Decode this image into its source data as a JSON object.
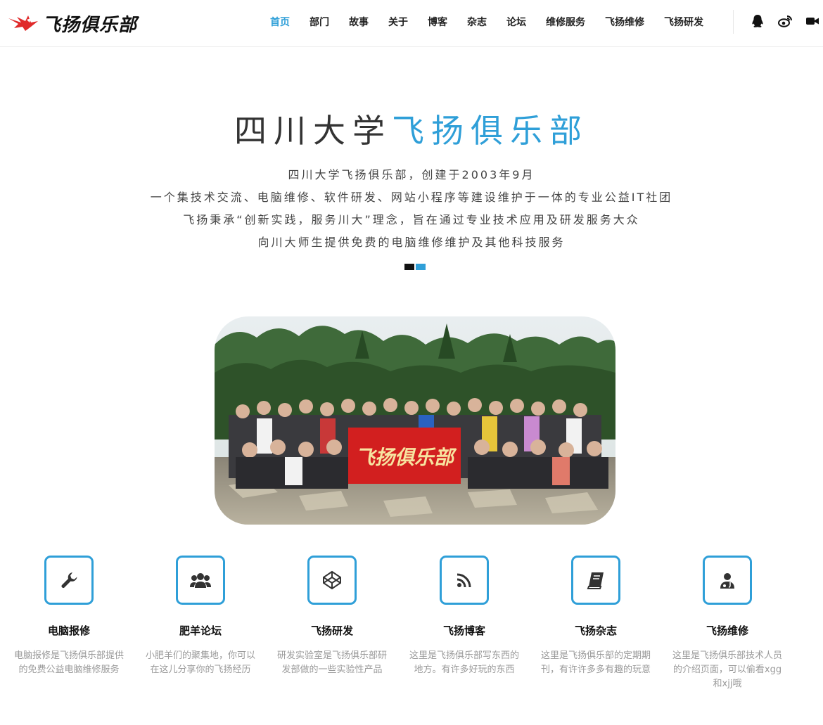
{
  "header": {
    "logo_text": "飞扬俱乐部",
    "nav": [
      {
        "label": "首页",
        "active": true
      },
      {
        "label": "部门"
      },
      {
        "label": "故事"
      },
      {
        "label": "关于"
      },
      {
        "label": "博客"
      },
      {
        "label": "杂志"
      },
      {
        "label": "论坛"
      },
      {
        "label": "维修服务"
      },
      {
        "label": "飞扬维修"
      },
      {
        "label": "飞扬研发"
      }
    ],
    "social_icons": [
      "qq-icon",
      "weibo-icon",
      "video-icon"
    ]
  },
  "hero": {
    "title_prefix": "四川大学",
    "title_highlight": "飞扬俱乐部",
    "lines": [
      "四川大学飞扬俱乐部，创建于2003年9月",
      "一个集技术交流、电脑维修、软件研发、网站小程序等建设维护于一体的专业公益IT社团",
      "飞扬秉承“创新实践，服务川大”理念，旨在通过专业技术应用及研发服务大众",
      "向川大师生提供免费的电脑维修维护及其他科技服务"
    ],
    "banner_text": "飞扬俱乐部"
  },
  "features": [
    {
      "icon": "wrench-icon",
      "title": "电脑报修",
      "desc": "电脑报修是飞扬俱乐部提供的免费公益电脑维修服务"
    },
    {
      "icon": "users-icon",
      "title": "肥羊论坛",
      "desc": "小肥羊们的聚集地，你可以在这儿分享你的飞扬经历"
    },
    {
      "icon": "codepen-icon",
      "title": "飞扬研发",
      "desc": "研发实验室是飞扬俱乐部研发部做的一些实验性产品"
    },
    {
      "icon": "rss-icon",
      "title": "飞扬博客",
      "desc": "这里是飞扬俱乐部写东西的地方。有许多好玩的东西"
    },
    {
      "icon": "book-icon",
      "title": "飞扬杂志",
      "desc": "这里是飞扬俱乐部的定期期刊，有许许多多有趣的玩意"
    },
    {
      "icon": "doctor-icon",
      "title": "飞扬维修",
      "desc": "这里是飞扬俱乐部技术人员的介绍页面，可以偷看xgg和xjj哦"
    }
  ],
  "colors": {
    "accent": "#2f9fd8",
    "text": "#222222",
    "muted": "#9a9a9a",
    "logo_red": "#e02a2a"
  }
}
